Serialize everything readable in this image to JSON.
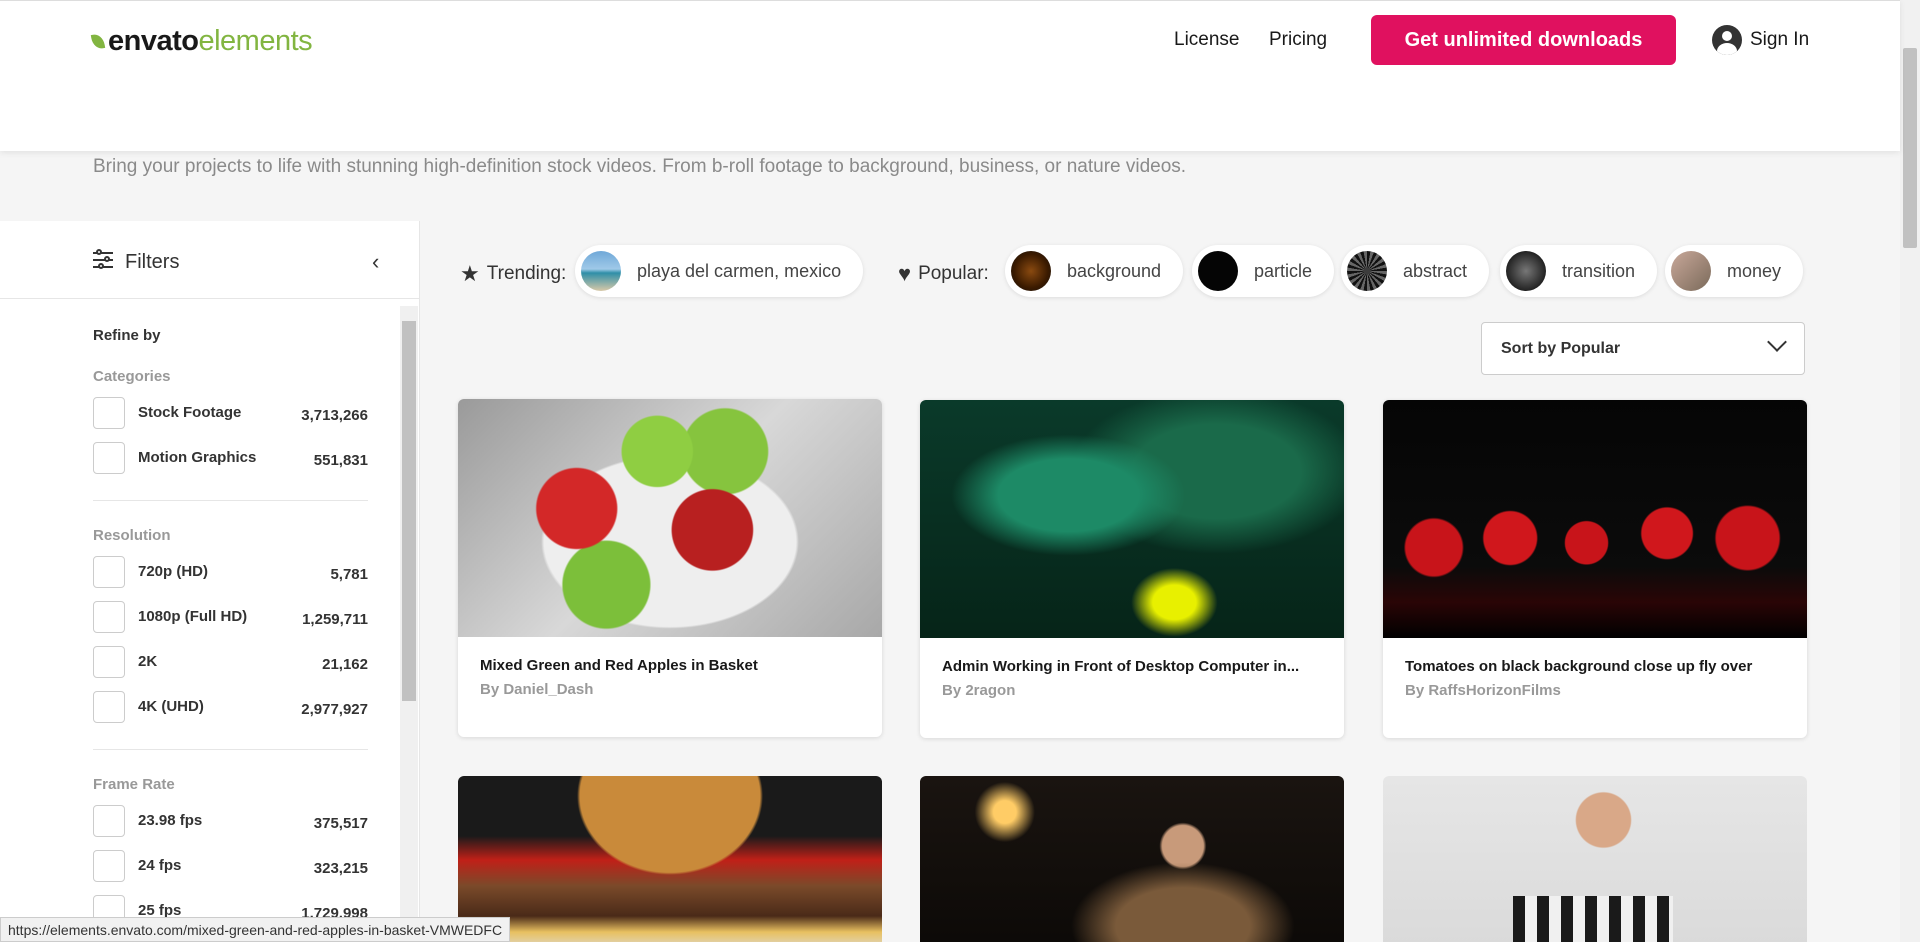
{
  "header": {
    "logo_envato": "envato",
    "logo_elements": "elements",
    "nav_license": "License",
    "nav_pricing": "Pricing",
    "cta": "Get unlimited downloads",
    "sign_in": "Sign In"
  },
  "subtitle": "Bring your projects to life with stunning high-definition stock videos. From b-roll footage to background, business, or nature videos.",
  "filters": {
    "title": "Filters",
    "refine_by": "Refine by",
    "categories_label": "Categories",
    "categories": [
      {
        "label": "Stock Footage",
        "count": "3,713,266"
      },
      {
        "label": "Motion Graphics",
        "count": "551,831"
      }
    ],
    "resolution_label": "Resolution",
    "resolution": [
      {
        "label": "720p (HD)",
        "count": "5,781"
      },
      {
        "label": "1080p (Full HD)",
        "count": "1,259,711"
      },
      {
        "label": "2K",
        "count": "21,162"
      },
      {
        "label": "4K (UHD)",
        "count": "2,977,927"
      }
    ],
    "frame_rate_label": "Frame Rate",
    "frame_rate": [
      {
        "label": "23.98 fps",
        "count": "375,517"
      },
      {
        "label": "24 fps",
        "count": "323,215"
      },
      {
        "label": "25 fps",
        "count": "1,729,998"
      }
    ]
  },
  "tags": {
    "trending_label": "Trending:",
    "trending": [
      "playa del carmen, mexico"
    ],
    "popular_label": "Popular:",
    "popular": [
      "background",
      "particle",
      "abstract",
      "transition",
      "money"
    ]
  },
  "sort": {
    "label": "Sort by Popular"
  },
  "cards": [
    {
      "title": "Mixed Green and Red Apples in Basket",
      "author": "By Daniel_Dash"
    },
    {
      "title": "Admin Working in Front of Desktop Computer in...",
      "author": "By 2ragon"
    },
    {
      "title": "Tomatoes on black background close up fly over",
      "author": "By RaffsHorizonFilms"
    }
  ],
  "status_url": "https://elements.envato.com/mixed-green-and-red-apples-in-basket-VMWEDFC",
  "colors": {
    "accent": "#e0115f",
    "brand": "#82b541"
  }
}
